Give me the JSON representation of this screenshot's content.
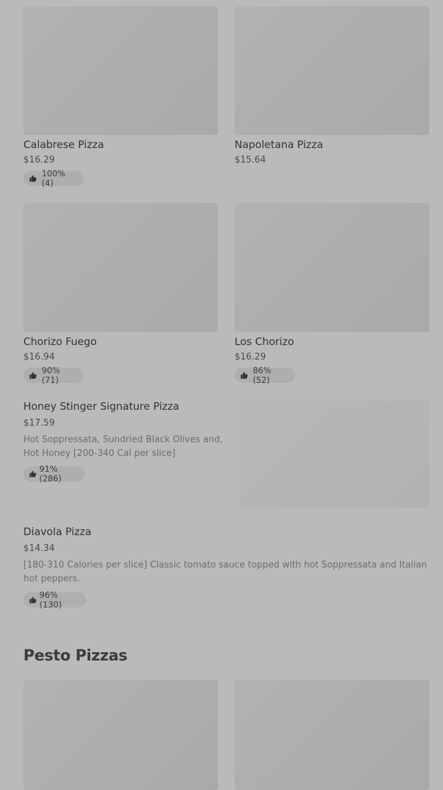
{
  "items": [
    {
      "name": "Calabrese Pizza",
      "price": "$16.29",
      "rating": "100% (4)"
    },
    {
      "name": "Napoletana Pizza",
      "price": "$15.64"
    },
    {
      "name": "Chorizo Fuego",
      "price": "$16.94",
      "rating": "90% (71)"
    },
    {
      "name": "Los Chorizo",
      "price": "$16.29",
      "rating": "86% (52)"
    },
    {
      "name": "Honey Stinger Signature Pizza",
      "price": "$17.59",
      "description": "Hot Soppressata, Sundried Black Olives and, Hot Honey [200-340 Cal per slice]",
      "rating": "91% (286)"
    },
    {
      "name": "Diavola Pizza",
      "price": "$14.34",
      "description": "[180-310 Calories per slice] Classic tomato sauce topped with hot Soppressata and Italian hot peppers.",
      "rating": "96% (130)"
    }
  ],
  "sections": [
    {
      "title": "Pesto Pizzas"
    }
  ],
  "icons": {
    "rating": "thumbs-up-icon"
  },
  "colors": {
    "background": "#bababa",
    "image_placeholder": "#adadad",
    "badge": "#aeaeae"
  }
}
